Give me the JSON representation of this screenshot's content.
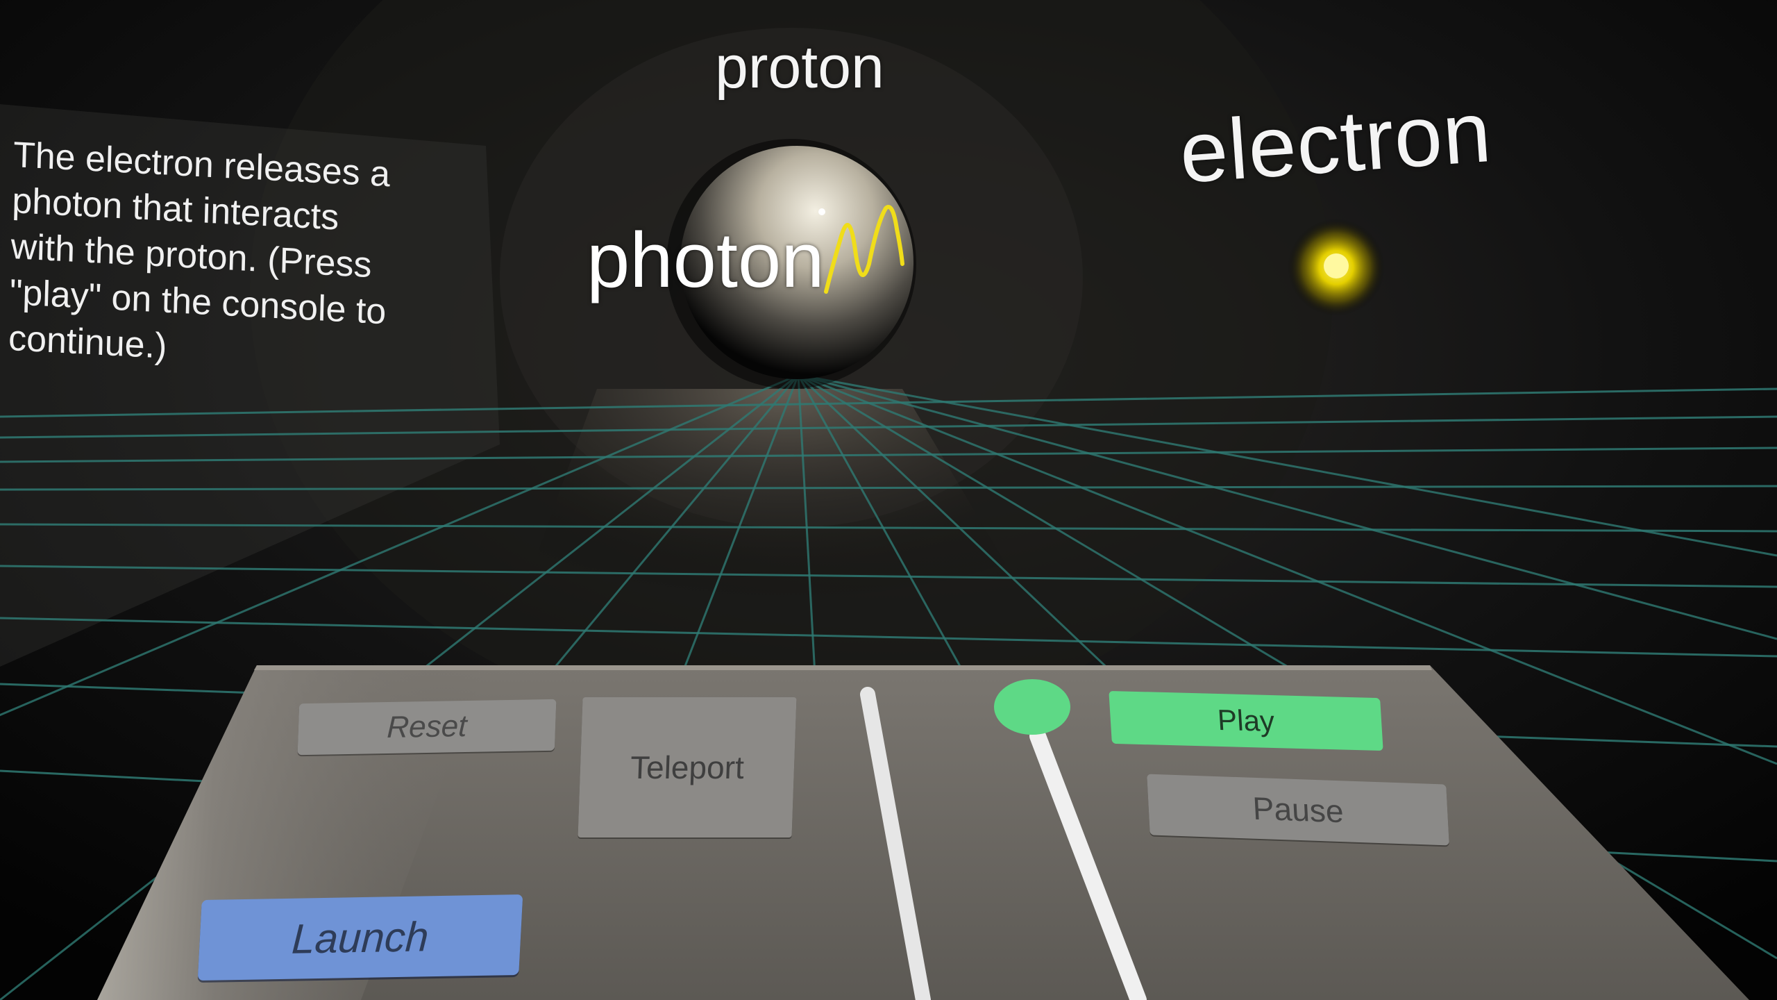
{
  "scene": {
    "proton_label": "proton",
    "electron_label": "electron",
    "photon_label": "photon",
    "photon_wave_color": "#f0dd1a",
    "electron_color": "#ffe600",
    "grid_color": "#2f7a73"
  },
  "info_panel": {
    "lines": [
      "The electron releases a",
      "photon that interacts",
      "with the proton. (Press",
      "\"play\" on the console to",
      "continue.)"
    ]
  },
  "console": {
    "reset_label": "Reset",
    "teleport_label": "Teleport",
    "launch_label": "Launch",
    "play_label": "Play",
    "pause_label": "Pause",
    "colors": {
      "panel": "#6f6b66",
      "play": "#5ed986",
      "launch": "#6f93d6",
      "gray_button": "#8c8a87"
    }
  }
}
